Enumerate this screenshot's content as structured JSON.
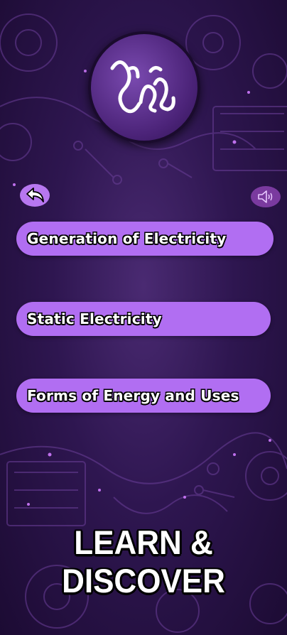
{
  "app": {
    "logo_text": "ශිල්පය"
  },
  "toolbar": {
    "back_icon": "back-arrow-icon",
    "sound_icon": "speaker-icon"
  },
  "menu": {
    "items": [
      {
        "label": "Generation of Electricity"
      },
      {
        "label": "Static Electricity"
      },
      {
        "label": "Forms of Energy and Uses"
      }
    ]
  },
  "footer": {
    "slogan": "LEARN & DISCOVER"
  },
  "colors": {
    "background": "#2e1650",
    "button": "#b16ef2",
    "back_button": "#b777f0",
    "sound_button": "#7a3a9f"
  }
}
